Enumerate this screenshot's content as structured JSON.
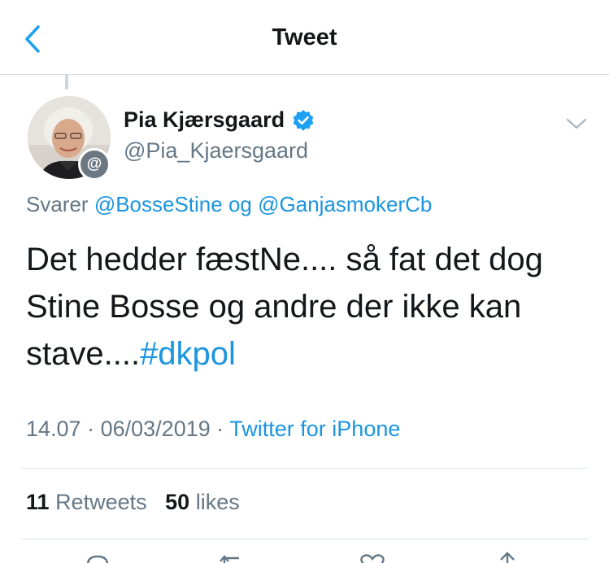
{
  "header": {
    "title": "Tweet"
  },
  "author": {
    "name": "Pia Kjærsgaard",
    "handle": "@Pia_Kjaersgaard",
    "badge_glyph": "@"
  },
  "reply": {
    "prefix": "Svarer",
    "mention1": "@BosseStine",
    "joiner": "og",
    "mention2": "@GanjasmokerCb"
  },
  "tweet": {
    "text": "Det hedder fæstNe.... så fat det dog Stine Bosse og andre der ikke kan stave....",
    "hashtag": "#dkpol"
  },
  "meta": {
    "time": "14.07",
    "date": "06/03/2019",
    "sep": "·",
    "source": "Twitter for iPhone"
  },
  "stats": {
    "retweets_count": "11",
    "retweets_label": "Retweets",
    "likes_count": "50",
    "likes_label": "likes"
  },
  "icons": {
    "back": "chevron-left-icon",
    "verified": "verified-badge-icon",
    "more": "chevron-down-icon",
    "reply": "reply-icon",
    "retweet": "retweet-icon",
    "like": "heart-icon",
    "share": "share-icon"
  },
  "colors": {
    "accent": "#1b95e0",
    "secondary_text": "#657786",
    "primary_text": "#14171a",
    "verified": "#1da1f2"
  }
}
